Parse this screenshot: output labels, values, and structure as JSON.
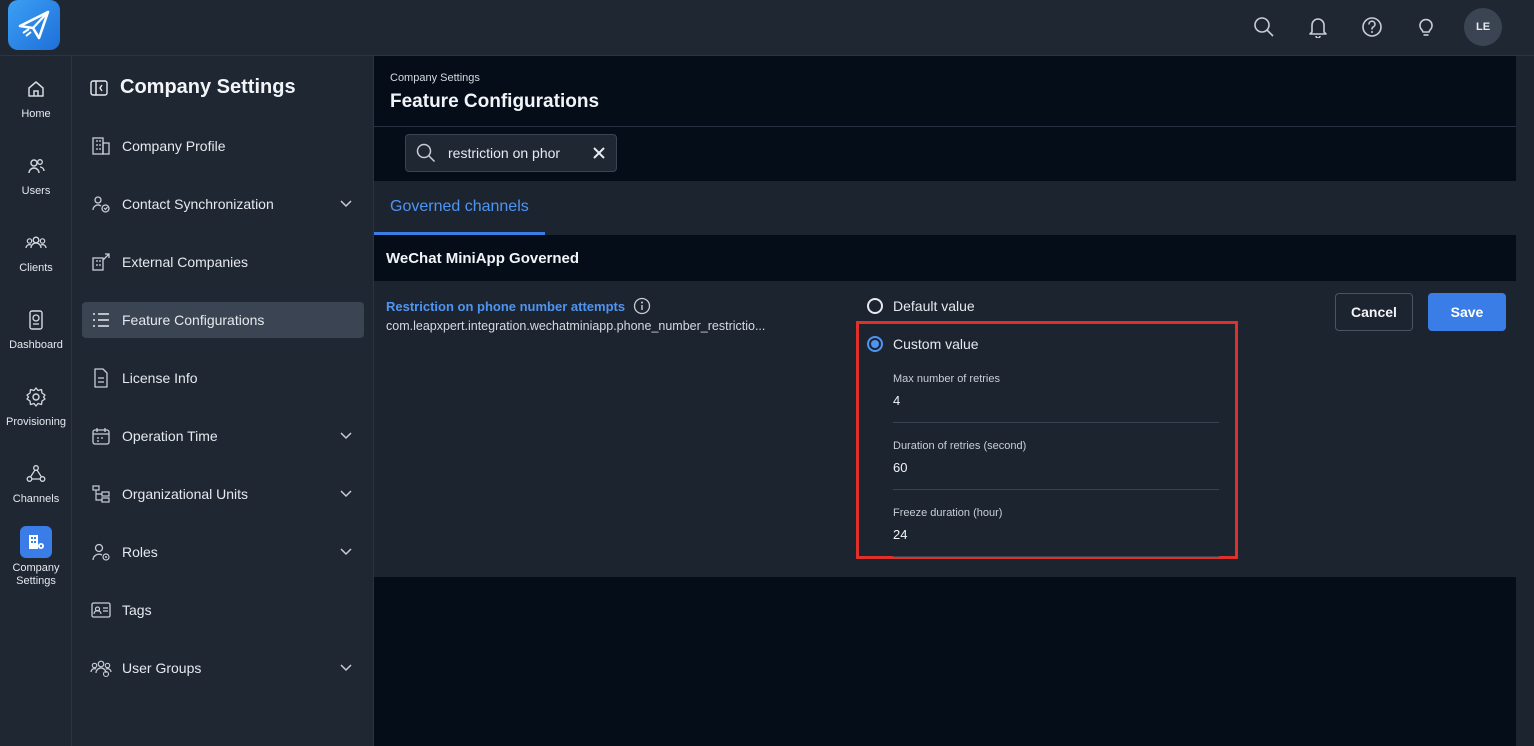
{
  "topbar": {
    "icons": [
      "search-icon",
      "bell-icon",
      "help-icon",
      "lightbulb-icon"
    ],
    "avatar_initials": "LE"
  },
  "rail": {
    "items": [
      {
        "label": "Home",
        "icon": "home-icon"
      },
      {
        "label": "Users",
        "icon": "users-icon"
      },
      {
        "label": "Clients",
        "icon": "clients-icon"
      },
      {
        "label": "Dashboard",
        "icon": "dashboard-icon"
      },
      {
        "label": "Provisioning",
        "icon": "gear-icon"
      },
      {
        "label": "Channels",
        "icon": "channels-icon"
      },
      {
        "label": "Company Settings",
        "icon": "building-icon",
        "active": true
      }
    ]
  },
  "sidebar": {
    "title": "Company Settings",
    "items": [
      {
        "label": "Company Profile",
        "expandable": false
      },
      {
        "label": "Contact Synchronization",
        "expandable": true
      },
      {
        "label": "External Companies",
        "expandable": false
      },
      {
        "label": "Feature Configurations",
        "expandable": false,
        "active": true
      },
      {
        "label": "License Info",
        "expandable": false
      },
      {
        "label": "Operation Time",
        "expandable": true
      },
      {
        "label": "Organizational Units",
        "expandable": true
      },
      {
        "label": "Roles",
        "expandable": true
      },
      {
        "label": "Tags",
        "expandable": false
      },
      {
        "label": "User Groups",
        "expandable": true
      }
    ]
  },
  "main": {
    "breadcrumb": "Company Settings",
    "title": "Feature Configurations",
    "search": {
      "value": "restriction on phor"
    },
    "tabs": [
      {
        "label": "Governed channels",
        "active": true
      }
    ],
    "section_title": "WeChat MiniApp Governed",
    "config": {
      "name": "Restriction on phone number attempts",
      "key": "com.leapxpert.integration.wechatminiapp.phone_number_restrictio...",
      "default_label": "Default value",
      "custom_label": "Custom value",
      "selected": "custom",
      "fields": [
        {
          "label": "Max number of retries",
          "value": "4"
        },
        {
          "label": "Duration of retries (second)",
          "value": "60"
        },
        {
          "label": "Freeze duration (hour)",
          "value": "24"
        }
      ]
    },
    "buttons": {
      "cancel": "Cancel",
      "save": "Save"
    }
  },
  "colors": {
    "accent": "#3a7de6",
    "link": "#4e95f2",
    "highlight_border": "#e0302a"
  }
}
